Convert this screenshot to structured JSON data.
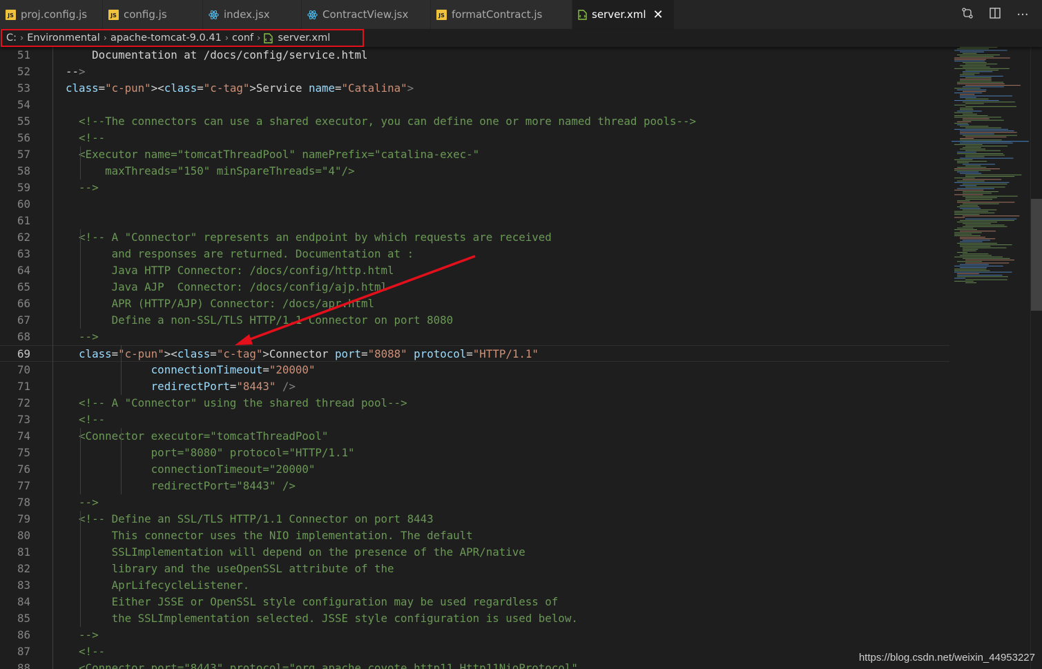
{
  "tabs": [
    {
      "label": "proj.config.js",
      "icon": "js-file-icon"
    },
    {
      "label": "config.js",
      "icon": "js-file-icon"
    },
    {
      "label": "index.jsx",
      "icon": "react-icon"
    },
    {
      "label": "ContractView.jsx",
      "icon": "react-icon"
    },
    {
      "label": "formatContract.js",
      "icon": "js-file-icon"
    },
    {
      "label": "server.xml",
      "icon": "xml-file-icon",
      "active": true,
      "close": "✕"
    }
  ],
  "editor_actions": [
    {
      "name": "open-changes-icon"
    },
    {
      "name": "split-editor-icon"
    },
    {
      "name": "more-actions-icon",
      "glyph": "···"
    }
  ],
  "breadcrumb": {
    "items": [
      "C:",
      "Environmental",
      "apache-tomcat-9.0.41",
      "conf",
      "server.xml"
    ],
    "separator": "›"
  },
  "colors": {
    "comment": "#6a9955",
    "tag": "#569cd6",
    "attribute": "#9cdcfe",
    "string": "#ce9178",
    "punctuation": "#808080",
    "highlight_box": "#e3101b",
    "arrow": "#e3101b"
  },
  "editor": {
    "current_line": 69,
    "lines": [
      {
        "n": "51",
        "t": "      Documentation at /docs/config/service.html"
      },
      {
        "n": "52",
        "t": "  -->"
      },
      {
        "n": "53",
        "t": "  <Service name=\"Catalina\">"
      },
      {
        "n": "54",
        "t": ""
      },
      {
        "n": "55",
        "t": "    <!--The connectors can use a shared executor, you can define one or more named thread pools-->"
      },
      {
        "n": "56",
        "t": "    <!--"
      },
      {
        "n": "57",
        "t": "    <Executor name=\"tomcatThreadPool\" namePrefix=\"catalina-exec-\""
      },
      {
        "n": "58",
        "t": "        maxThreads=\"150\" minSpareThreads=\"4\"/>"
      },
      {
        "n": "59",
        "t": "    -->"
      },
      {
        "n": "60",
        "t": ""
      },
      {
        "n": "61",
        "t": ""
      },
      {
        "n": "62",
        "t": "    <!-- A \"Connector\" represents an endpoint by which requests are received"
      },
      {
        "n": "63",
        "t": "         and responses are returned. Documentation at :"
      },
      {
        "n": "64",
        "t": "         Java HTTP Connector: /docs/config/http.html"
      },
      {
        "n": "65",
        "t": "         Java AJP  Connector: /docs/config/ajp.html"
      },
      {
        "n": "66",
        "t": "         APR (HTTP/AJP) Connector: /docs/apr.html"
      },
      {
        "n": "67",
        "t": "         Define a non-SSL/TLS HTTP/1.1 Connector on port 8080"
      },
      {
        "n": "68",
        "t": "    -->"
      },
      {
        "n": "69",
        "t": "    <Connector port=\"8088\" protocol=\"HTTP/1.1\""
      },
      {
        "n": "70",
        "t": "               connectionTimeout=\"20000\""
      },
      {
        "n": "71",
        "t": "               redirectPort=\"8443\" />"
      },
      {
        "n": "72",
        "t": "    <!-- A \"Connector\" using the shared thread pool-->"
      },
      {
        "n": "73",
        "t": "    <!--"
      },
      {
        "n": "74",
        "t": "    <Connector executor=\"tomcatThreadPool\""
      },
      {
        "n": "75",
        "t": "               port=\"8080\" protocol=\"HTTP/1.1\""
      },
      {
        "n": "76",
        "t": "               connectionTimeout=\"20000\""
      },
      {
        "n": "77",
        "t": "               redirectPort=\"8443\" />"
      },
      {
        "n": "78",
        "t": "    -->"
      },
      {
        "n": "79",
        "t": "    <!-- Define an SSL/TLS HTTP/1.1 Connector on port 8443"
      },
      {
        "n": "80",
        "t": "         This connector uses the NIO implementation. The default"
      },
      {
        "n": "81",
        "t": "         SSLImplementation will depend on the presence of the APR/native"
      },
      {
        "n": "82",
        "t": "         library and the useOpenSSL attribute of the"
      },
      {
        "n": "83",
        "t": "         AprLifecycleListener."
      },
      {
        "n": "84",
        "t": "         Either JSSE or OpenSSL style configuration may be used regardless of"
      },
      {
        "n": "85",
        "t": "         the SSLImplementation selected. JSSE style configuration is used below."
      },
      {
        "n": "86",
        "t": "    -->"
      },
      {
        "n": "87",
        "t": "    <!--"
      },
      {
        "n": "88",
        "t": "    <Connector port=\"8443\" protocol=\"org.apache.coyote.http11.Http11NioProtocol\""
      }
    ]
  },
  "watermark": "https://blog.csdn.net/weixin_44953227"
}
